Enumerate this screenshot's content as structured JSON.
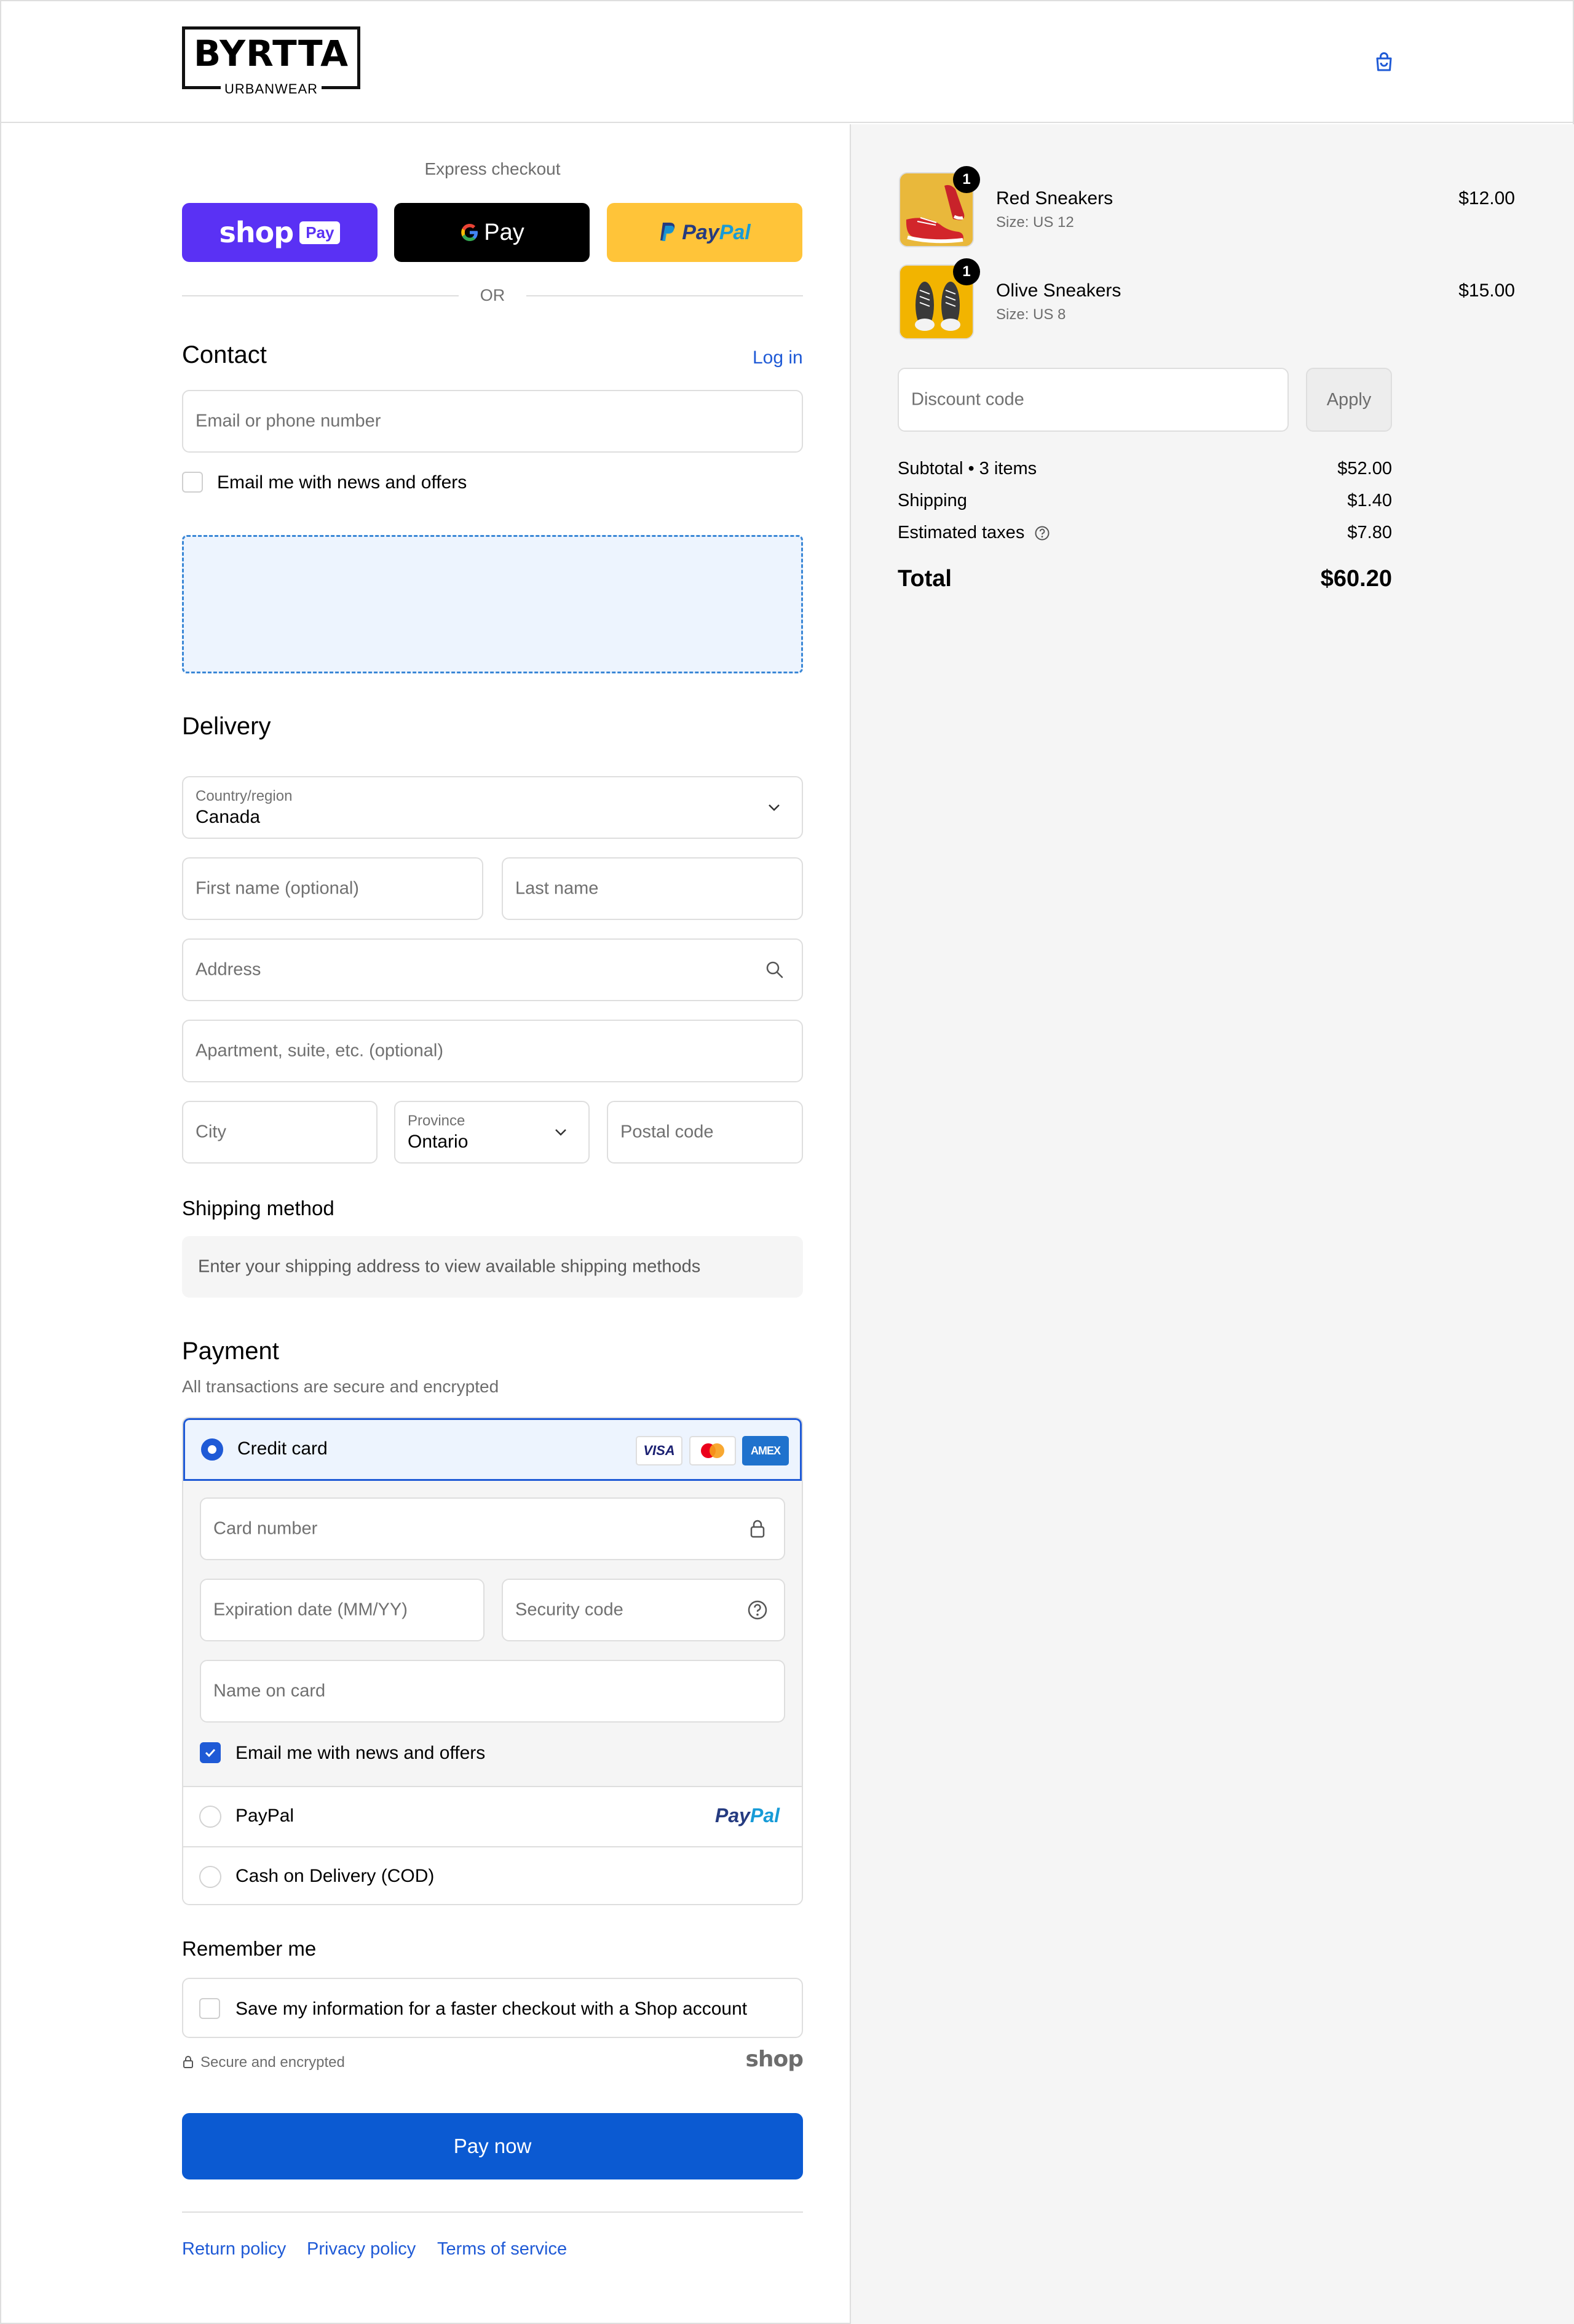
{
  "header": {
    "brand": "BYRTTA",
    "brand_sub": "URBANWEAR"
  },
  "express": {
    "label": "Express checkout",
    "shop_pay_word": "shop",
    "shop_pay_badge": "Pay",
    "google_pay_word": "Pay",
    "paypal_word_1": "Pay",
    "paypal_word_2": "Pal",
    "or_label": "OR"
  },
  "contact": {
    "title": "Contact",
    "login_link": "Log in",
    "email_placeholder": "Email or phone number",
    "newsletter_label": "Email me with news and offers"
  },
  "delivery": {
    "title": "Delivery",
    "country_label": "Country/region",
    "country_value": "Canada",
    "first_name_placeholder": "First name (optional)",
    "last_name_placeholder": "Last name",
    "address_placeholder": "Address",
    "apartment_placeholder": "Apartment, suite, etc. (optional)",
    "city_placeholder": "City",
    "province_label": "Province",
    "province_value": "Ontario",
    "postal_placeholder": "Postal code"
  },
  "shipping": {
    "title": "Shipping method",
    "info": "Enter your shipping address to view available shipping methods"
  },
  "payment": {
    "title": "Payment",
    "subtitle": "All transactions are secure and encrypted",
    "credit_card_label": "Credit card",
    "card_brands": [
      "VISA",
      "Mastercard",
      "AMEX"
    ],
    "card_number_placeholder": "Card number",
    "expiration_placeholder": "Expiration date (MM/YY)",
    "security_placeholder": "Security code",
    "name_on_card_placeholder": "Name on card",
    "billing_newsletter_label": "Email me with news and offers",
    "paypal_label": "PayPal",
    "cod_label": "Cash on Delivery (COD)"
  },
  "remember": {
    "title": "Remember me",
    "save_label": "Save my information for a faster checkout with a Shop account",
    "secure_label": "Secure and encrypted",
    "shop_logo": "shop"
  },
  "pay_now_label": "Pay now",
  "footer_links": [
    "Return policy",
    "Privacy policy",
    "Terms of service"
  ],
  "summary": {
    "items": [
      {
        "name": "Red Sneakers",
        "variant": "Size: US 12",
        "price": "$12.00",
        "quantity": "1"
      },
      {
        "name": "Olive Sneakers",
        "variant": "Size: US 8",
        "price": "$15.00",
        "quantity": "1"
      }
    ],
    "discount_placeholder": "Discount code",
    "apply_label": "Apply",
    "subtotal_label": "Subtotal • 3 items",
    "subtotal_value": "$52.00",
    "shipping_label": "Shipping",
    "shipping_value": "$1.40",
    "taxes_label": "Estimated taxes",
    "taxes_value": "$7.80",
    "total_label": "Total",
    "total_value": "$60.20"
  },
  "colors": {
    "accent": "#1f5ad6",
    "pay_now": "#0b5ad2",
    "shop_pay": "#5a31f4",
    "paypal_yellow": "#ffc439",
    "summary_bg": "#f5f5f5"
  }
}
